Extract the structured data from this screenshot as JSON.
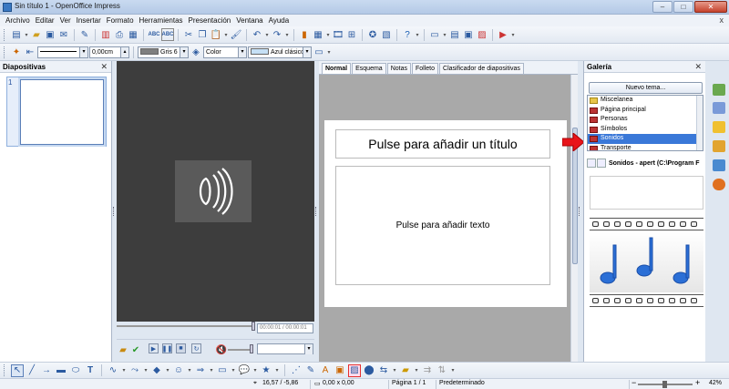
{
  "window": {
    "title": "Sin título 1 - OpenOffice Impress",
    "minimize": "–",
    "maximize": "□",
    "close": "✕"
  },
  "menu": {
    "items": [
      "Archivo",
      "Editar",
      "Ver",
      "Insertar",
      "Formato",
      "Herramientas",
      "Presentación",
      "Ventana",
      "Ayuda"
    ],
    "close_doc": "x"
  },
  "format_toolbar": {
    "line_width": "0,00cm",
    "line_color": "Gris 6",
    "area_style": "Color",
    "area_color": "Azul clásico",
    "line_color_hex": "#7f7f7f",
    "area_color_hex": "#c5e0f5"
  },
  "slides_panel": {
    "title": "Diapositivas",
    "slide_number": "1"
  },
  "media_player": {
    "time_display": "00:00:01 / 00:00:01"
  },
  "editor": {
    "tabs": [
      {
        "label": "Normal",
        "active": true
      },
      {
        "label": "Esquema",
        "active": false
      },
      {
        "label": "Notas",
        "active": false
      },
      {
        "label": "Folleto",
        "active": false
      },
      {
        "label": "Clasificador de diapositivas",
        "active": false
      }
    ],
    "title_placeholder": "Pulse para añadir un título",
    "text_placeholder": "Pulse para añadir texto"
  },
  "gallery": {
    "title": "Galería",
    "new_theme_button": "Nuevo tema...",
    "themes": [
      {
        "label": "Miscelanea",
        "icon": "folder-icon",
        "selected": false
      },
      {
        "label": "Página principal",
        "icon": "theme-icon",
        "selected": false
      },
      {
        "label": "Personas",
        "icon": "theme-icon",
        "selected": false
      },
      {
        "label": "Símbolos",
        "icon": "theme-icon",
        "selected": false
      },
      {
        "label": "Sonidos",
        "icon": "theme-icon",
        "selected": true
      },
      {
        "label": "Transporte",
        "icon": "theme-icon",
        "selected": false
      }
    ],
    "info": "Sonidos - apert (C:\\Program F"
  },
  "status": {
    "position": "16,57 / -5,86",
    "size": "0,00 x 0,00",
    "page": "Página 1 / 1",
    "layout": "Predeterminado",
    "zoom": "42%"
  },
  "colors": {
    "selection": "#3a78d8",
    "media_bg": "#3d3d3d",
    "canvas_bg": "#a9a9a9",
    "arrow": "#e8141a",
    "note_blue": "#2b6fd6"
  }
}
